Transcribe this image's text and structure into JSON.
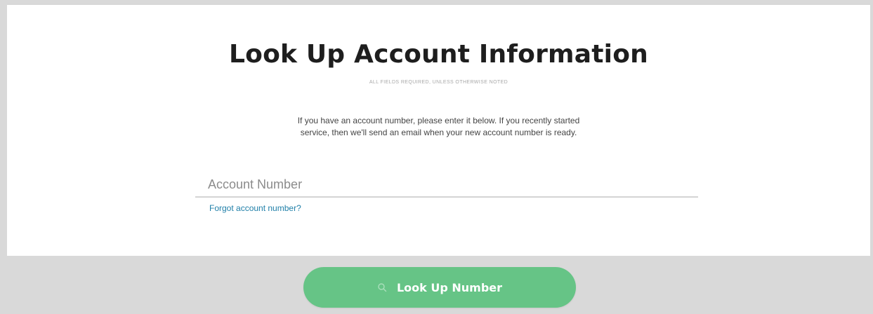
{
  "page": {
    "title": "Look Up Account Information",
    "subtitle": "ALL FIELDS REQUIRED, UNLESS OTHERWISE NOTED",
    "intro_line1": "If you have an account number, please enter it below. If you recently started",
    "intro_line2": "service, then we'll send an email when your new account number is ready."
  },
  "form": {
    "account_number_placeholder": "Account Number",
    "account_number_value": "",
    "forgot_link": "Forgot account number?"
  },
  "actions": {
    "lookup_label": "Look Up Number",
    "lookup_icon": "search-icon"
  },
  "colors": {
    "button_bg": "#66c486",
    "link": "#1f7fa8",
    "footer_band": "#d9d9d9"
  }
}
